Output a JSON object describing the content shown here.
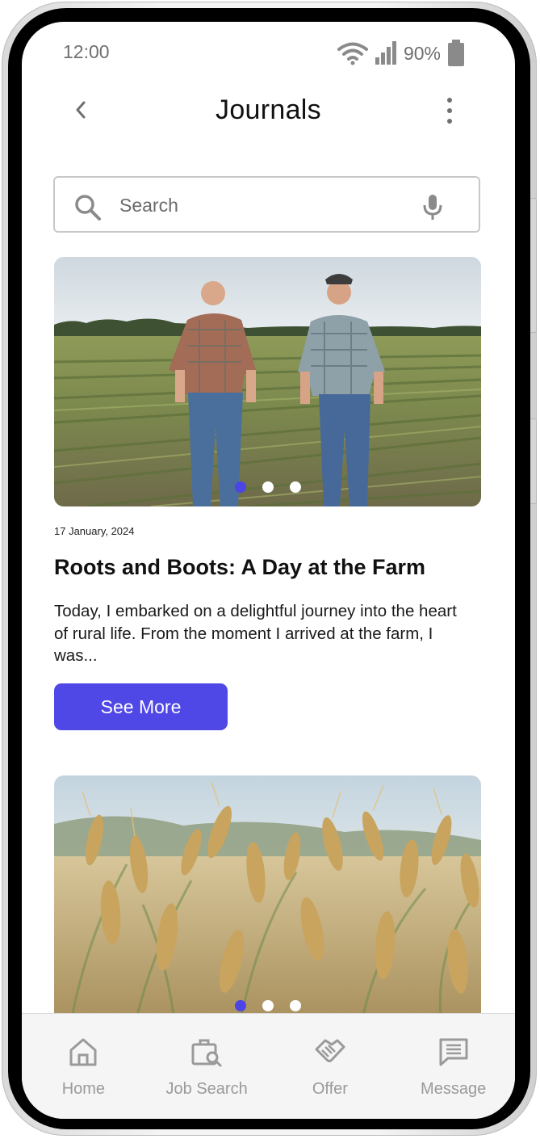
{
  "status_bar": {
    "time": "12:00",
    "battery": "90%"
  },
  "header": {
    "title": "Journals"
  },
  "search": {
    "placeholder": "Search"
  },
  "articles": [
    {
      "date": "17 January, 2024",
      "title": "Roots and Boots: A Day at the Farm",
      "excerpt": "Today, I embarked on a delightful journey into the heart of rural life. From the moment I arrived at the farm, I was...",
      "button_label": "See More",
      "image": "two-farmers-walking-in-field",
      "carousel": {
        "count": 3,
        "active": 1
      }
    },
    {
      "image": "wheat-field-closeup",
      "carousel": {
        "count": 3,
        "active": 1
      }
    }
  ],
  "bottom_nav": [
    {
      "label": "Home",
      "icon": "home-icon"
    },
    {
      "label": "Job Search",
      "icon": "job-search-icon"
    },
    {
      "label": "Offer",
      "icon": "handshake-icon"
    },
    {
      "label": "Message",
      "icon": "message-icon"
    }
  ],
  "colors": {
    "accent": "#4f47e6",
    "nav_background": "#f5f5f5",
    "muted_text": "#9a9a9a"
  }
}
